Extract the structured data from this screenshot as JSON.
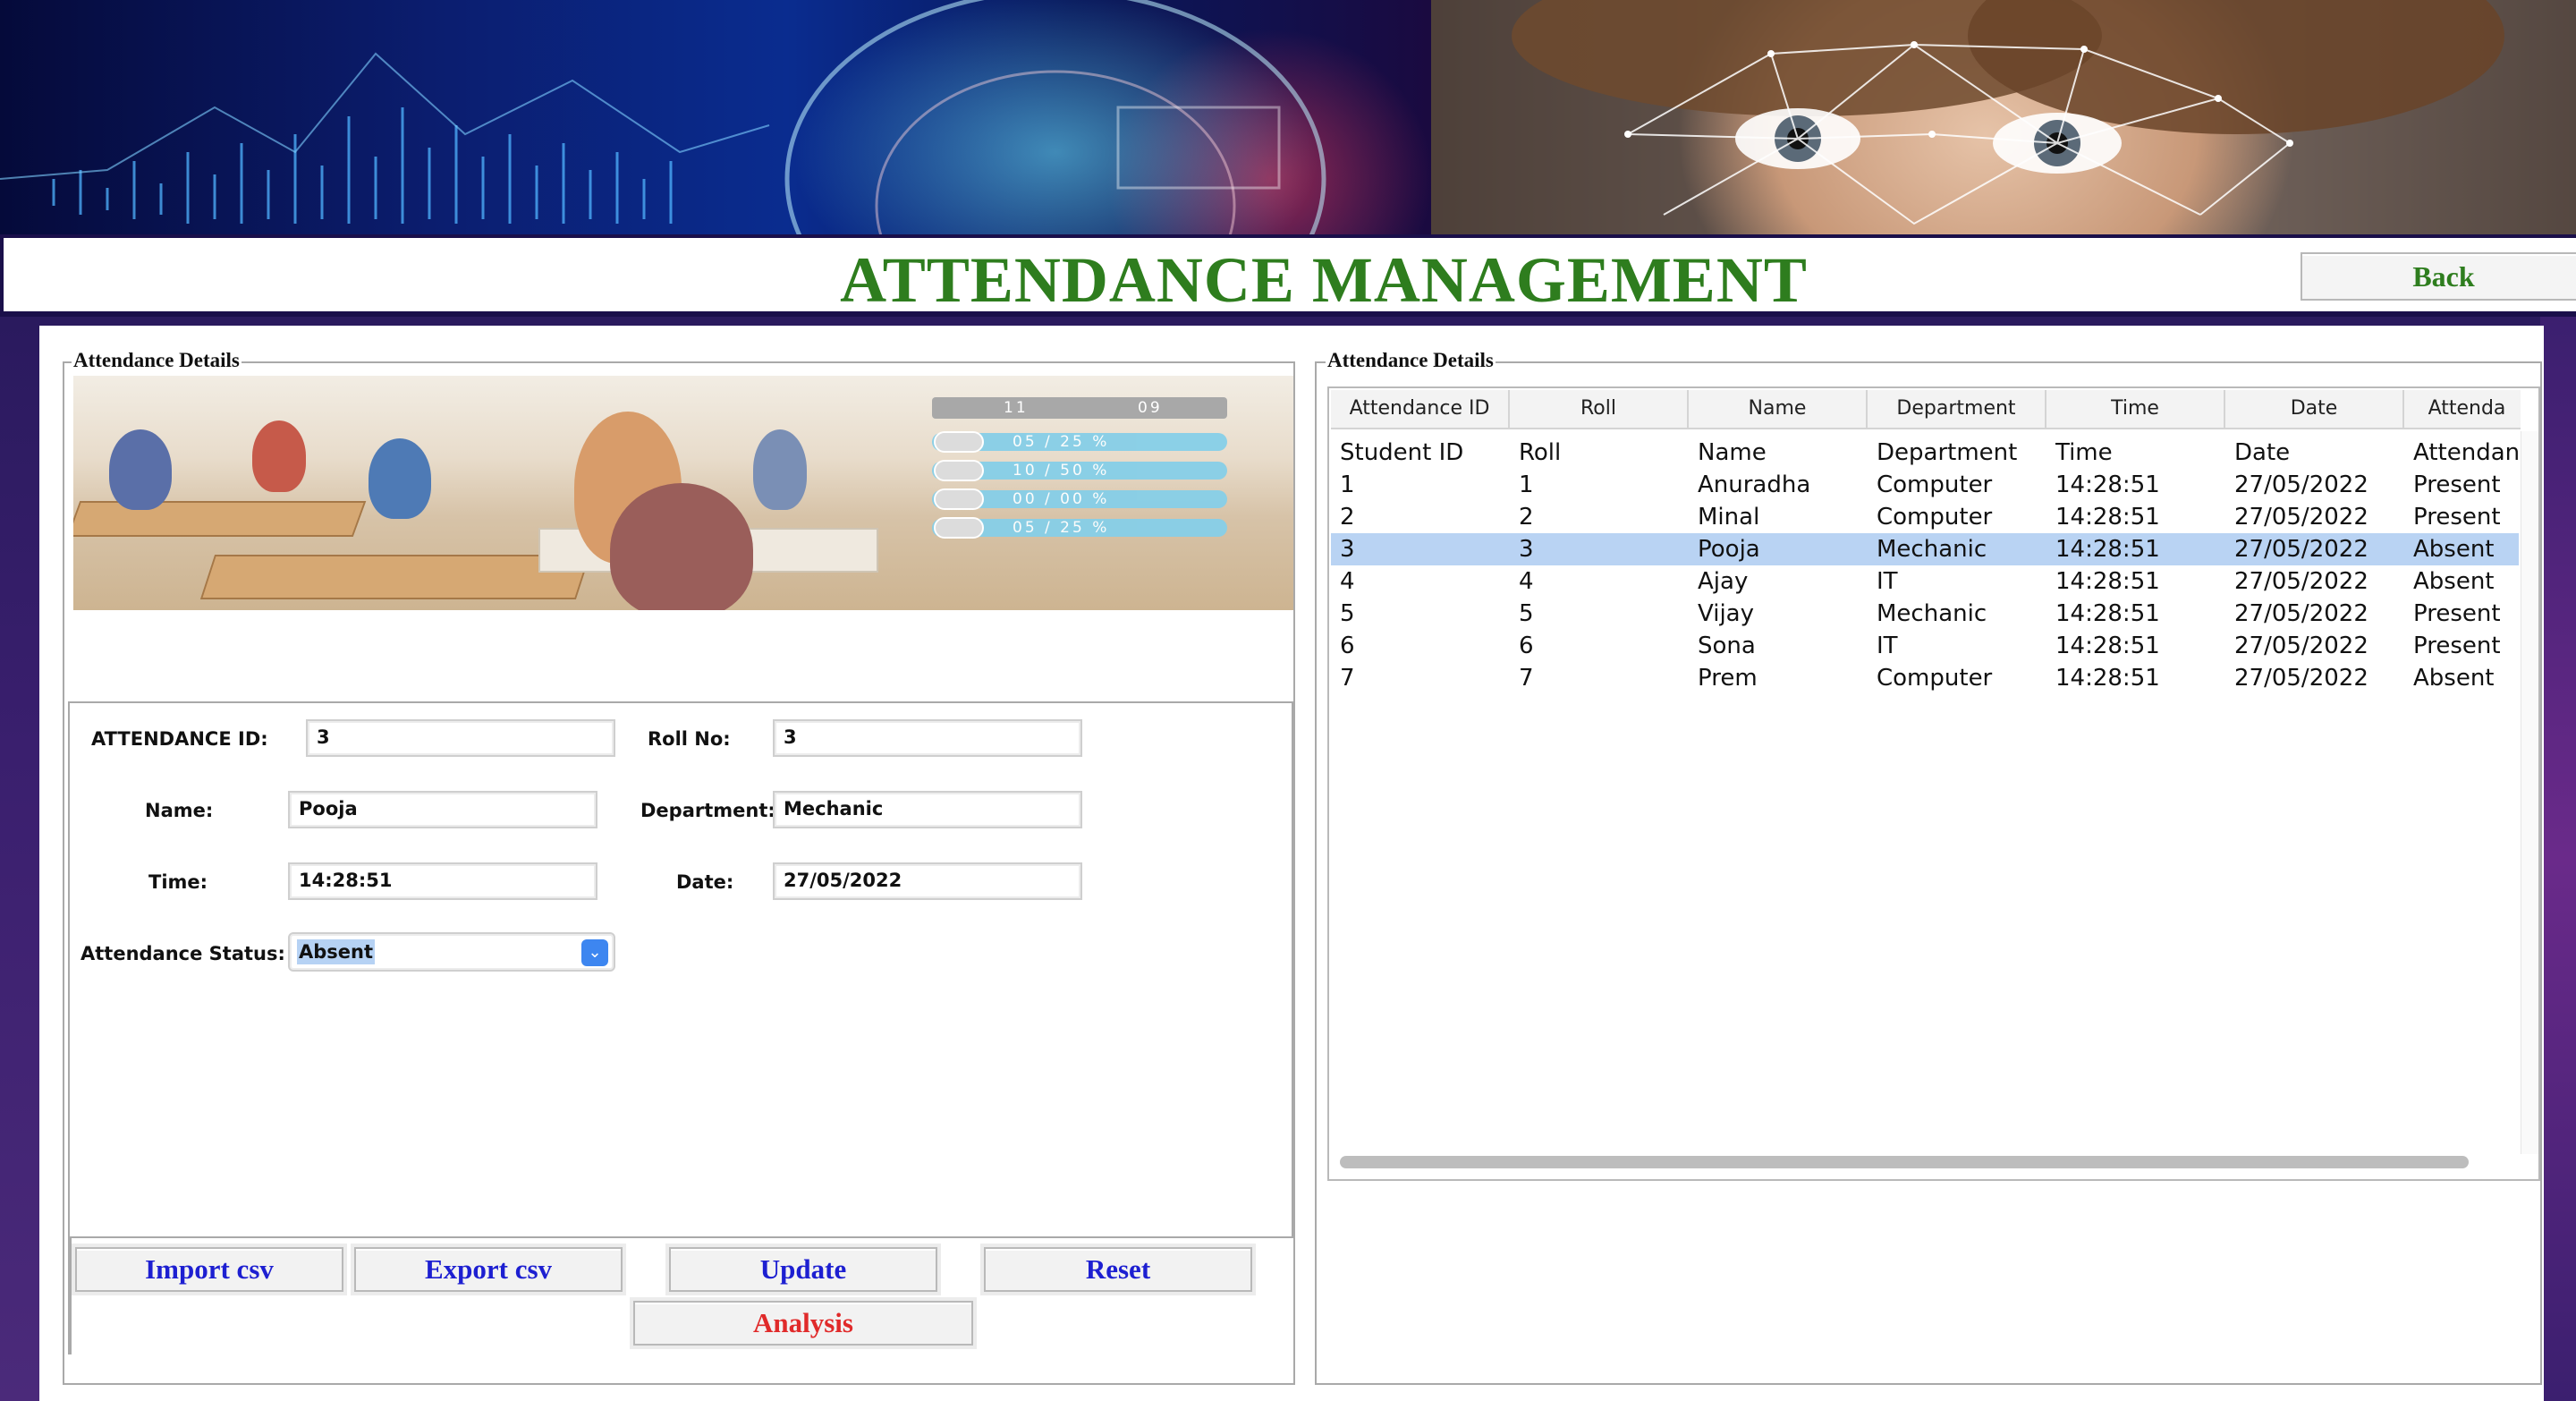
{
  "header": {
    "title": "ATTENDANCE MANAGEMENT",
    "back_label": "Back"
  },
  "left_panel": {
    "legend": "Attendance Details",
    "image_stats": {
      "top_left": "11",
      "top_right": "09",
      "rows": [
        "05 / 25 %",
        "10 / 50 %",
        "00 / 00 %",
        "05 / 25 %"
      ]
    },
    "form": {
      "attendance_id_label": "ATTENDANCE ID:",
      "attendance_id_value": "3",
      "roll_label": "Roll No:",
      "roll_value": "3",
      "name_label": "Name:",
      "name_value": "Pooja",
      "department_label": "Department:",
      "department_value": "Mechanic",
      "time_label": "Time:",
      "time_value": "14:28:51",
      "date_label": "Date:",
      "date_value": "27/05/2022",
      "status_label": "Attendance Status:",
      "status_value": "Absent"
    },
    "buttons": {
      "import_csv": "Import csv",
      "export_csv": "Export csv",
      "update": "Update",
      "reset": "Reset",
      "analysis": "Analysis"
    }
  },
  "right_panel": {
    "legend": "Attendance Details",
    "columns": [
      "Attendance ID",
      "Roll",
      "Name",
      "Department",
      "Time",
      "Date",
      "Attenda"
    ],
    "rows": [
      [
        "Student ID",
        "Roll",
        "Name",
        "Department",
        "Time",
        "Date",
        "Attendanc"
      ],
      [
        "1",
        "1",
        "Anuradha",
        "Computer",
        "14:28:51",
        "27/05/2022",
        "Present"
      ],
      [
        "2",
        "2",
        "Minal",
        "Computer",
        "14:28:51",
        "27/05/2022",
        "Present"
      ],
      [
        "3",
        "3",
        "Pooja",
        "Mechanic",
        "14:28:51",
        "27/05/2022",
        "Absent"
      ],
      [
        "4",
        "4",
        "Ajay",
        "IT",
        "14:28:51",
        "27/05/2022",
        "Absent"
      ],
      [
        "5",
        "5",
        "Vijay",
        "Mechanic",
        "14:28:51",
        "27/05/2022",
        "Present"
      ],
      [
        "6",
        "6",
        "Sona",
        "IT",
        "14:28:51",
        "27/05/2022",
        "Present"
      ],
      [
        "7",
        "7",
        "Prem",
        "Computer",
        "14:28:51",
        "27/05/2022",
        "Absent"
      ]
    ],
    "selected_row": 3
  },
  "colors": {
    "title_green": "#2e7d1e",
    "button_blue": "#1d1fd1",
    "analysis_red": "#e02a2a",
    "selection_blue": "#b9d3f3",
    "frame_navy": "#1a0f4a"
  }
}
